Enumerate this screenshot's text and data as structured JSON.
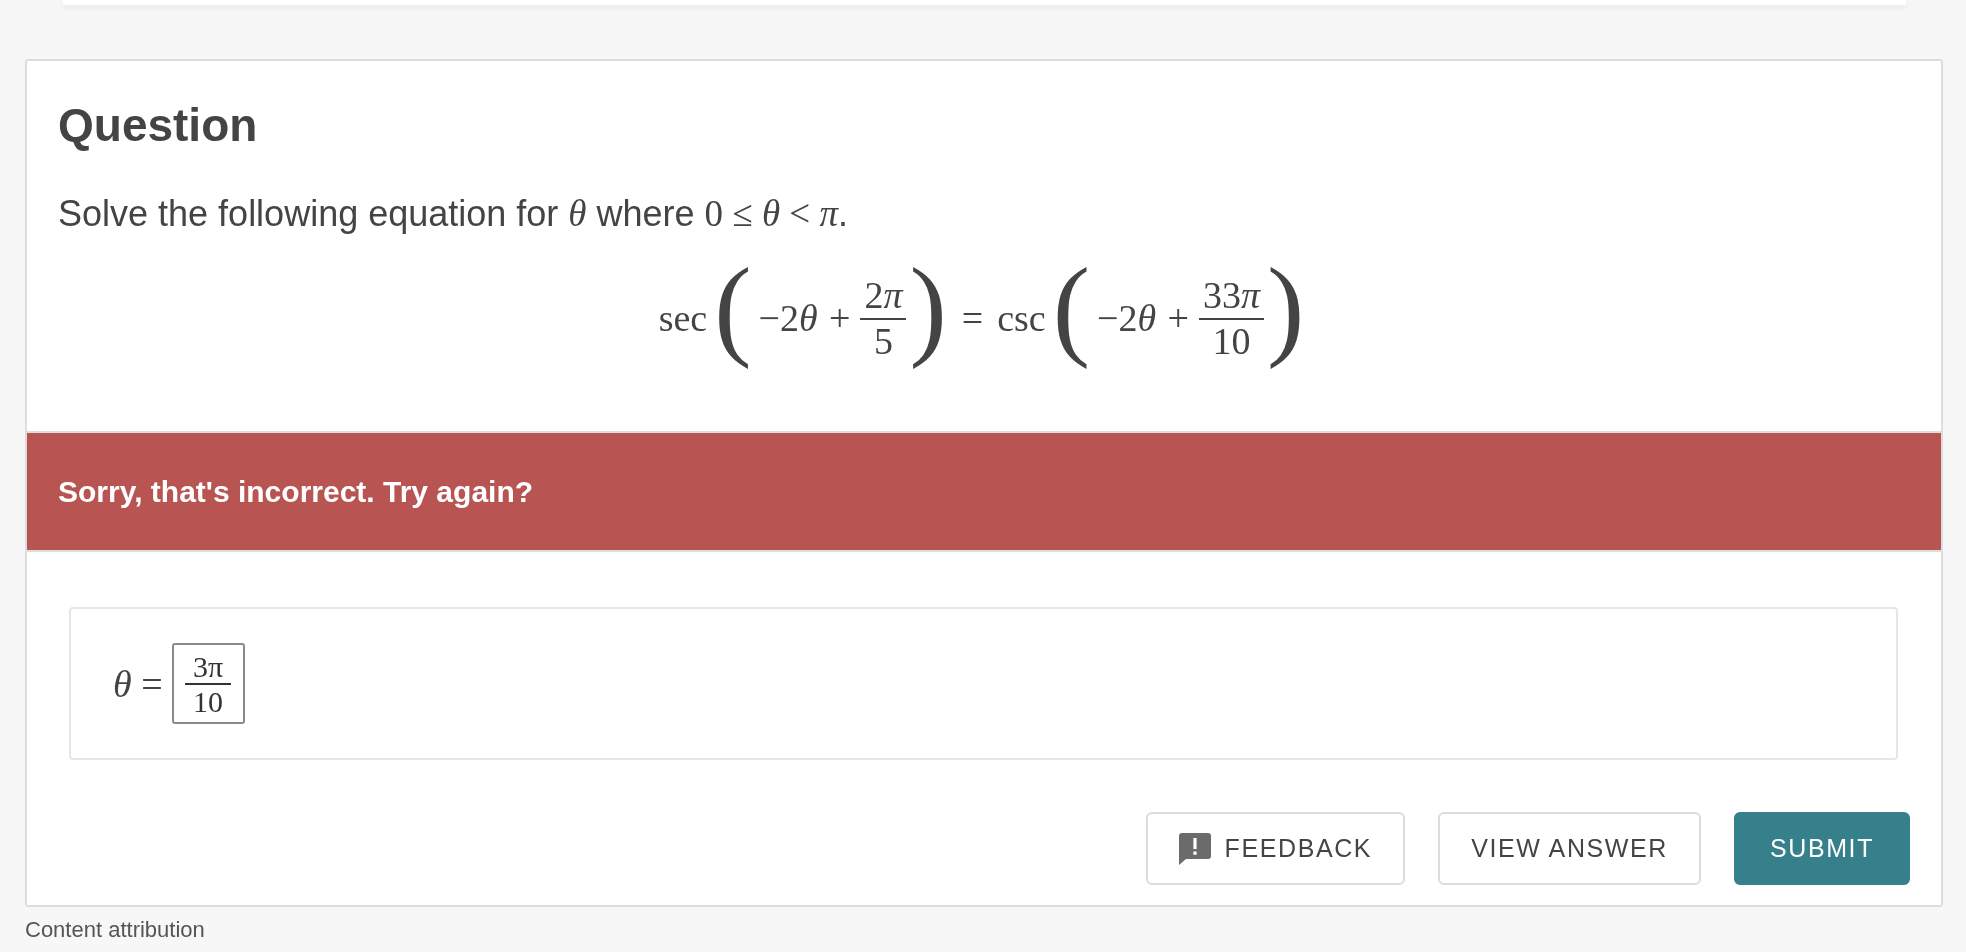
{
  "question": {
    "title": "Question",
    "prompt": [
      {
        "kind": "text",
        "text": "Solve the following equation for "
      },
      {
        "kind": "math",
        "text": "*θ*"
      },
      {
        "kind": "text",
        "text": " where "
      },
      {
        "kind": "math",
        "text": "0 ≤ *θ* < *π*"
      },
      {
        "kind": "text",
        "text": "."
      }
    ],
    "equation": {
      "sides": [
        {
          "function": "sec",
          "open": "(",
          "term": [
            {
              "kind": "sign",
              "text": "−"
            },
            {
              "kind": "number",
              "text": "2"
            },
            {
              "kind": "variable",
              "text": "θ"
            },
            {
              "kind": "binary_op",
              "text": "+"
            }
          ],
          "fraction": {
            "numerator": [
              {
                "kind": "number",
                "text": "2"
              },
              {
                "kind": "variable",
                "text": "π"
              }
            ],
            "denominator": "5"
          },
          "close": ")"
        },
        {
          "function": "csc",
          "open": "(",
          "term": [
            {
              "kind": "sign",
              "text": "−"
            },
            {
              "kind": "number",
              "text": "2"
            },
            {
              "kind": "variable",
              "text": "θ"
            },
            {
              "kind": "binary_op",
              "text": "+"
            }
          ],
          "fraction": {
            "numerator": [
              {
                "kind": "number",
                "text": "33"
              },
              {
                "kind": "variable",
                "text": "π"
              }
            ],
            "denominator": "10"
          },
          "close": ")"
        }
      ],
      "relation": "="
    }
  },
  "feedback": {
    "correct": false,
    "message": "Sorry, that's incorrect. Try again?"
  },
  "answer": {
    "label": "*θ* =",
    "value": {
      "numerator": "3π",
      "denominator": "10"
    }
  },
  "buttons": [
    {
      "kind": "feedback",
      "label": "FEEDBACK"
    },
    {
      "kind": "view_answer",
      "label": "VIEW ANSWER"
    },
    {
      "kind": "submit",
      "label": "SUBMIT"
    }
  ],
  "footer": {
    "heading": "Content attribution"
  }
}
